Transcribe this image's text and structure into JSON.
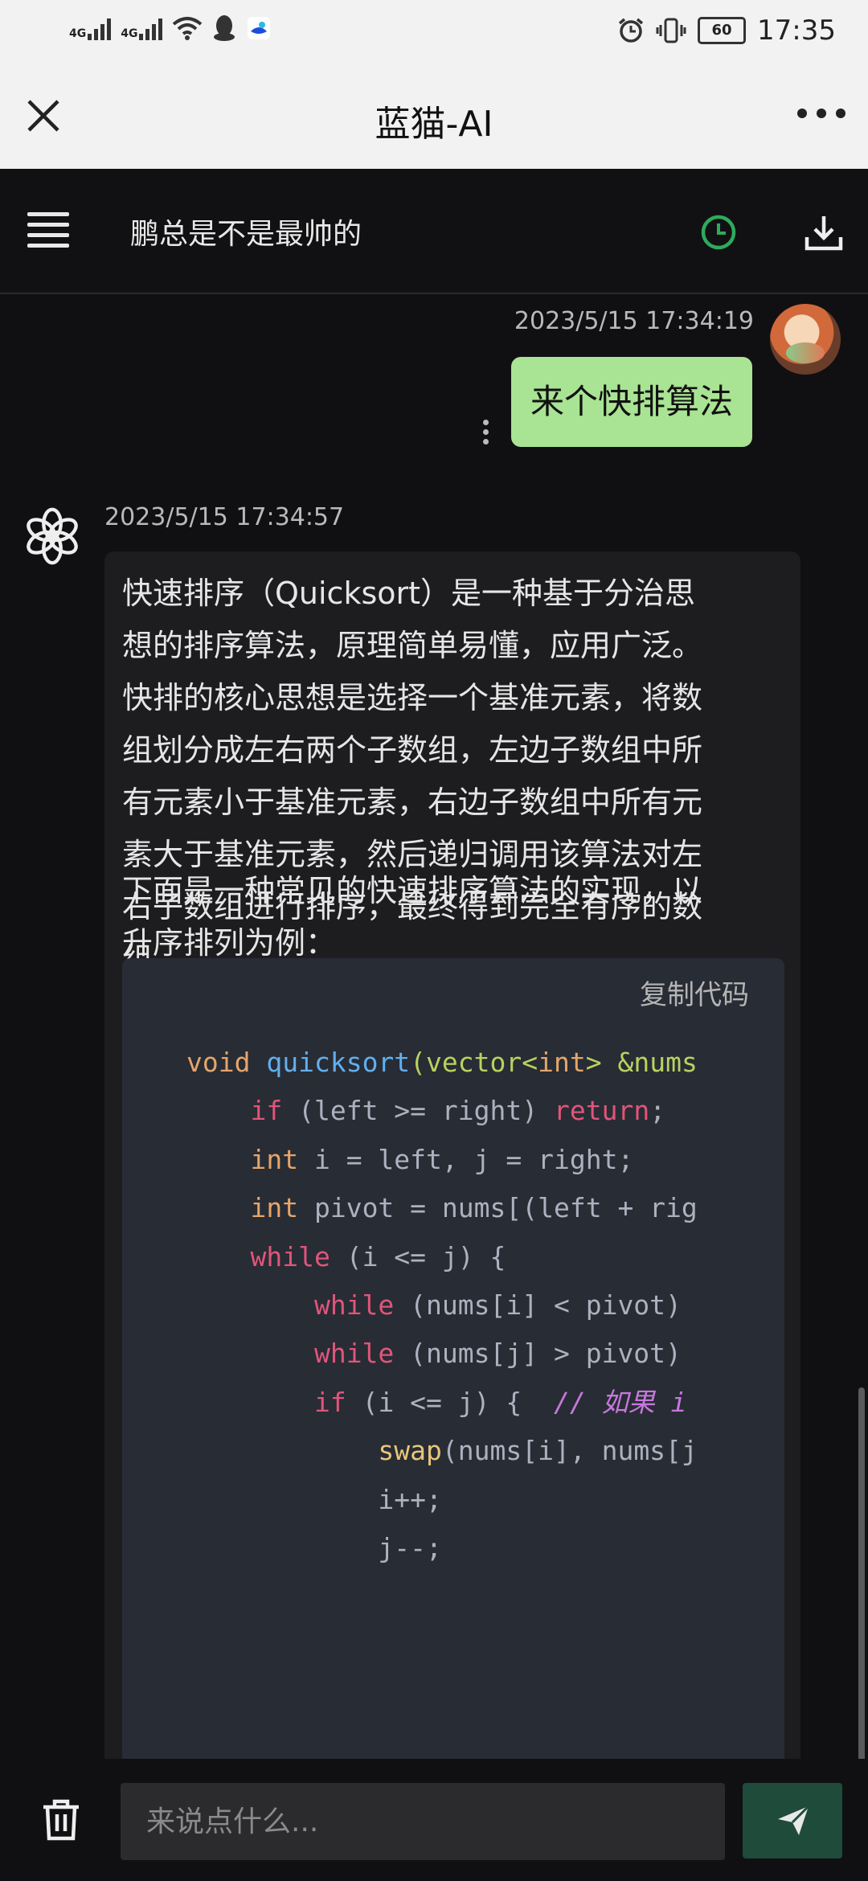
{
  "status_bar": {
    "left": {
      "signal1": "4G",
      "signal2": "4G",
      "icons": [
        "wifi-icon",
        "qq-icon",
        "app-icon"
      ]
    },
    "right": {
      "alarm": "alarm-icon",
      "vibrate": "vibrate-icon",
      "battery": "60",
      "time": "17:35"
    }
  },
  "titlebar": {
    "title": "蓝猫-AI"
  },
  "header": {
    "conversation_title": "鹏总是不是最帅的"
  },
  "messages": {
    "user": {
      "time": "2023/5/15 17:34:19",
      "text": "来个快排算法"
    },
    "assistant": {
      "time": "2023/5/15 17:34:57",
      "p1_lines": [
        "快速排序（Quicksort）是一种基于分治思",
        "想的排序算法，原理简单易懂，应用广泛。",
        "快排的核心思想是选择一个基准元素，将数",
        "组划分成左右两个子数组，左边子数组中所",
        "有元素小于基准元素，右边子数组中所有元",
        "素大于基准元素，然后递归调用该算法对左",
        "右子数组进行排序，最终得到完全有序的数",
        "组。"
      ],
      "p2_lines": [
        "下面是一种常见的快速排序算法的实现，以",
        "升序排列为例："
      ],
      "copy_label": "复制代码",
      "code_lines": [
        "void quicksort(vector<int> &nums",
        "    if (left >= right) return;",
        "    int i = left, j = right;",
        "    int pivot = nums[(left + rig",
        "    while (i <= j) {",
        "        while (nums[i] < pivot)",
        "        while (nums[j] > pivot)",
        "        if (i <= j) {  // 如果 i",
        "            swap(nums[i], nums[j",
        "            i++;",
        "            j--;"
      ]
    }
  },
  "input": {
    "placeholder": "来说点什么..."
  },
  "colors": {
    "user_bubble": "#a9e394",
    "history_icon": "#2faa5c",
    "send_button": "#1f4b3b"
  }
}
